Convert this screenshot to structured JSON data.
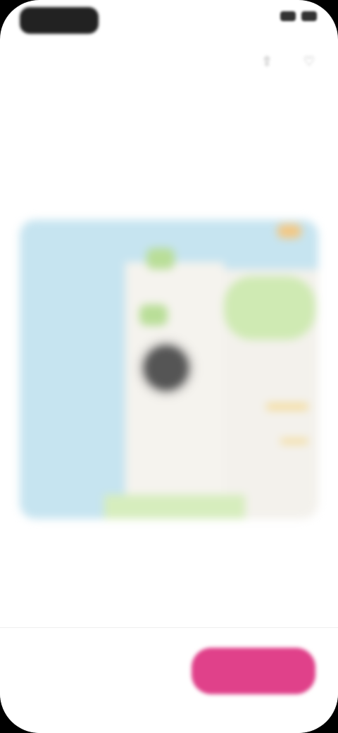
{
  "status_bar": {
    "time": "",
    "icons": [
      "signal-icon",
      "battery-icon"
    ]
  },
  "top_actions": {
    "share_icon": "share-icon",
    "favorite_icon": "heart-icon"
  },
  "header": {
    "title": "",
    "subtitle": ""
  },
  "map": {
    "pin_icon": "location-pin-icon",
    "colors": {
      "water": "#c6e4f0",
      "park": "#cfeab3",
      "land": "#f3f1ec",
      "pin": "#555555"
    }
  },
  "map_footer": {
    "text": ""
  },
  "footer": {
    "price": "",
    "price_sub": "",
    "cta_label": "",
    "cta_color": "#e0418a"
  }
}
